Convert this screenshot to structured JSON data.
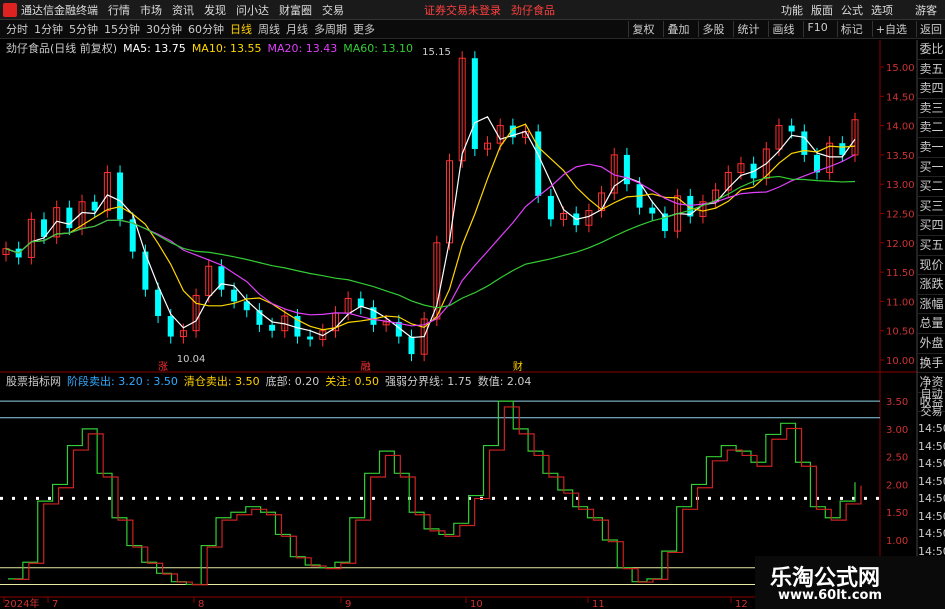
{
  "menu": {
    "app": "通达信金融终端",
    "items": [
      "行情",
      "市场",
      "资讯",
      "发现",
      "问小达",
      "财富圈",
      "交易"
    ],
    "notice": "证券交易未登录",
    "stock": "劲仔食品",
    "right": [
      "功能",
      "版面",
      "公式",
      "选项"
    ],
    "guest": "游客"
  },
  "toolbar": {
    "periods": [
      "分时",
      "1分钟",
      "5分钟",
      "15分钟",
      "30分钟",
      "60分钟",
      "日线",
      "周线",
      "月线",
      "多周期",
      "更多"
    ],
    "active": "日线",
    "right": [
      "复权",
      "叠加",
      "多股",
      "统计",
      "画线",
      "F10",
      "标记",
      "+自选",
      "返回"
    ]
  },
  "main": {
    "title": "劲仔食品(日线 前复权)",
    "ma": [
      {
        "label": "MA5: 13.75",
        "color": "#ffffff"
      },
      {
        "label": "MA10: 13.55",
        "color": "#ffd700"
      },
      {
        "label": "MA20: 13.43",
        "color": "#e040fb"
      },
      {
        "label": "MA60: 13.10",
        "color": "#33cc33"
      }
    ],
    "y_ticks": [
      "15.00",
      "14.50",
      "14.00",
      "13.50",
      "13.00",
      "12.50",
      "12.00",
      "11.50",
      "11.00",
      "10.50",
      "10.00"
    ],
    "low_label": "10.04",
    "high_label": "15.15",
    "markers": [
      "涨",
      "融",
      "财"
    ]
  },
  "sub": {
    "title": "股票指标网",
    "stats": [
      {
        "label": "阶段卖出: 3.20 : 3.50",
        "color": "#33aaff"
      },
      {
        "label": "清仓卖出: 3.50",
        "color": "#ffd000"
      },
      {
        "label": "底部: 0.20",
        "color": "#cccccc"
      },
      {
        "label": "关注: 0.50",
        "color": "#ffd000"
      },
      {
        "label": "强弱分界线: 1.75",
        "color": "#cccccc"
      },
      {
        "label": "数值: 2.04",
        "color": "#cccccc"
      }
    ],
    "y_ticks": [
      "3.50",
      "3.00",
      "2.50",
      "2.00",
      "1.50",
      "1.00"
    ]
  },
  "x_axis": [
    "2024年",
    "7",
    "8",
    "9",
    "10",
    "11",
    "12"
  ],
  "right_panel": [
    "委比",
    "卖五",
    "卖四",
    "卖三",
    "卖二",
    "卖一",
    "买一",
    "买二",
    "买三",
    "买四",
    "买五",
    "现价",
    "涨跌",
    "涨幅",
    "总量",
    "外盘",
    "换手",
    "净资",
    "收益"
  ],
  "right_panel2": [
    "自动",
    "交易",
    "14:50",
    "14:50",
    "14:50",
    "14:50",
    "14:50",
    "14:50",
    "14:50",
    "14:50"
  ],
  "watermark": {
    "title": "乐淘公式网",
    "url": "www.60lt.com"
  },
  "chart_data": {
    "type": "candlestick",
    "close": [
      11.9,
      11.75,
      12.4,
      12.1,
      12.6,
      12.25,
      12.7,
      12.55,
      13.2,
      12.4,
      11.85,
      11.2,
      10.75,
      10.4,
      10.5,
      11.1,
      11.6,
      11.2,
      11.0,
      10.85,
      10.6,
      10.5,
      10.75,
      10.4,
      10.35,
      10.5,
      10.8,
      11.05,
      10.9,
      10.6,
      10.65,
      10.4,
      10.1,
      10.7,
      12.0,
      13.4,
      15.15,
      13.6,
      13.7,
      14.0,
      13.8,
      13.9,
      12.8,
      12.4,
      12.5,
      12.3,
      12.55,
      12.85,
      13.5,
      13.0,
      12.6,
      12.5,
      12.2,
      12.8,
      12.45,
      12.7,
      12.9,
      13.2,
      13.35,
      13.1,
      13.6,
      14.0,
      13.9,
      13.5,
      13.2,
      13.7,
      13.5,
      14.1
    ],
    "ma_last": {
      "MA5": 13.75,
      "MA10": 13.55,
      "MA20": 13.43,
      "MA60": 13.1
    },
    "ylim": [
      10.0,
      15.0
    ],
    "indicator": {
      "values": [
        0.3,
        0.6,
        1.7,
        2.0,
        2.7,
        3.0,
        2.2,
        1.4,
        0.9,
        0.6,
        0.4,
        0.25,
        0.2,
        0.9,
        1.4,
        1.5,
        1.6,
        1.5,
        1.1,
        0.7,
        0.55,
        0.5,
        0.6,
        1.4,
        2.2,
        2.6,
        2.2,
        1.5,
        1.2,
        1.1,
        1.3,
        1.8,
        2.7,
        3.5,
        3.0,
        2.6,
        2.2,
        1.9,
        1.6,
        1.4,
        1.0,
        0.5,
        0.25,
        0.3,
        0.8,
        1.6,
        2.0,
        2.5,
        2.7,
        2.6,
        2.4,
        2.9,
        3.1,
        2.4,
        1.6,
        1.4,
        1.7,
        2.04
      ],
      "lines": [
        3.5,
        3.2,
        1.75,
        0.5,
        0.2
      ],
      "ylim": [
        0.1,
        3.7
      ]
    }
  }
}
